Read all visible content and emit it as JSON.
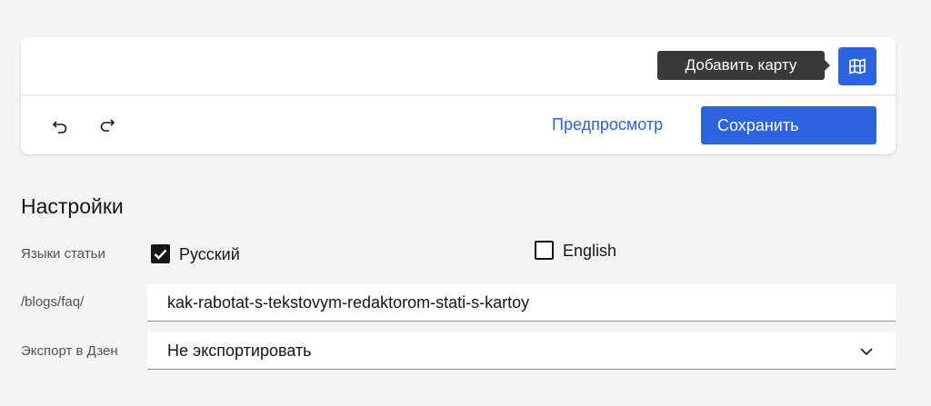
{
  "toolbar": {
    "tooltip": "Добавить карту",
    "map_icon": "map-grid-icon",
    "undo_icon": "undo-icon",
    "redo_icon": "redo-icon",
    "preview_label": "Предпросмотр",
    "save_label": "Сохранить"
  },
  "settings": {
    "title": "Настройки",
    "languages": {
      "label": "Языки статьи",
      "options": [
        {
          "label": "Русский",
          "checked": true
        },
        {
          "label": "English",
          "checked": false
        }
      ]
    },
    "url": {
      "label": "/blogs/faq/",
      "value": "kak-rabotat-s-tekstovym-redaktorom-stati-s-kartoy"
    },
    "export": {
      "label": "Экспорт в Дзен",
      "value": "Не экспортировать",
      "chevron_icon": "chevron-down-icon"
    }
  },
  "colors": {
    "accent": "#2b63e0",
    "background": "#f4f4f4",
    "tooltip_bg": "#393939"
  }
}
